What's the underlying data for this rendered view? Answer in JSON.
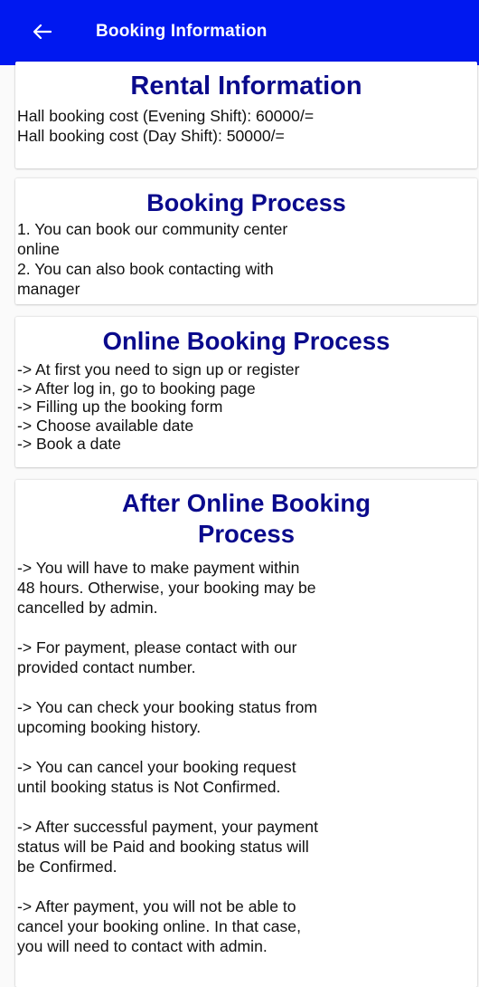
{
  "appbar": {
    "title": "Booking Information",
    "back_icon": "arrow-left-icon",
    "color": "#0018f0"
  },
  "rental": {
    "title": "Rental Information",
    "lines": [
      "Hall booking cost (Evening Shift): 60000/=",
      "Hall booking cost (Day Shift): 50000/="
    ]
  },
  "booking_process": {
    "title": "Booking Process",
    "lines": [
      "1. You can book our community center",
      "online",
      "2. You can also book contacting with",
      "manager"
    ]
  },
  "online_booking": {
    "title": "Online Booking Process",
    "lines": [
      "-> At first you need to sign up or register",
      "-> After log in, go to booking page",
      "-> Filling up the booking form",
      "-> Choose available date",
      "-> Book a date"
    ]
  },
  "after_online": {
    "title_line1": "After Online Booking",
    "title_line2": "Process",
    "paragraphs": [
      [
        "-> You will have to make payment within",
        "48 hours. Otherwise, your booking may be",
        "cancelled by admin."
      ],
      [
        "-> For payment, please contact with our",
        "provided contact number."
      ],
      [
        "-> You can check your booking status from",
        "upcoming booking history."
      ],
      [
        "-> You can cancel your booking request",
        "until booking status is Not Confirmed."
      ],
      [
        "-> After successful payment, your payment",
        "status will be Paid and booking status will",
        "be Confirmed."
      ],
      [
        "-> After payment, you will not be able to",
        "cancel your booking online. In that case,",
        "you will need to contact with admin."
      ]
    ]
  },
  "colors": {
    "heading": "#0a0a8c",
    "background": "#fafafa"
  }
}
